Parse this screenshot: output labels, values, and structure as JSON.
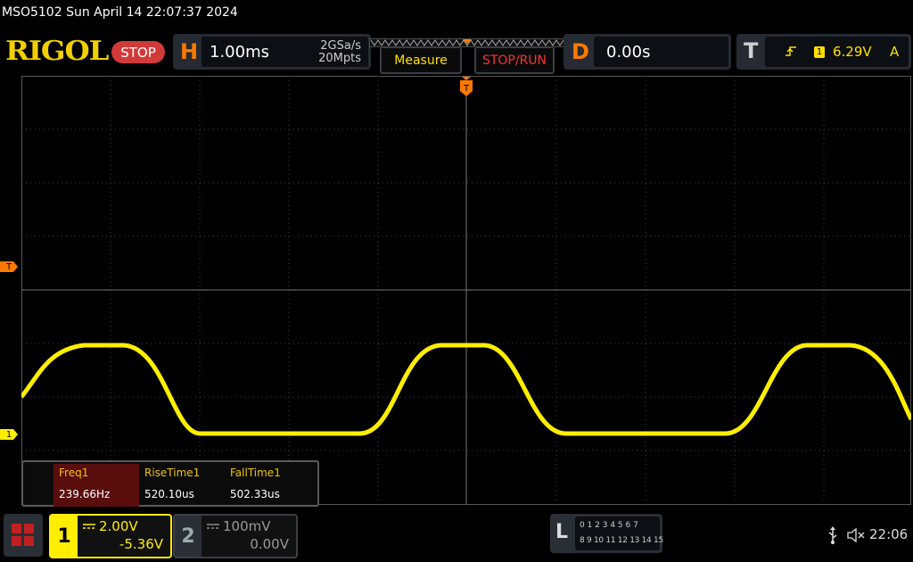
{
  "status_bar": {
    "text": "MSO5102  Sun April 14 22:07:37 2024"
  },
  "brand": {
    "logo": "RIGOL",
    "run_state": "STOP"
  },
  "horizontal": {
    "letter": "H",
    "timebase": "1.00ms",
    "sample_rate": "2GSa/s",
    "memory_depth": "20Mpts"
  },
  "buttons": {
    "measure": "Measure",
    "stop_run": "STOP/RUN"
  },
  "delay": {
    "letter": "D",
    "value": "0.00s"
  },
  "trigger": {
    "letter": "T",
    "source": "1",
    "level": "6.29V",
    "mode": "A"
  },
  "markers": {
    "trigger_level": "T",
    "channel1": "1"
  },
  "measurements": {
    "items": [
      {
        "label": "Freq1",
        "value": "239.66Hz"
      },
      {
        "label": "RiseTime1",
        "value": "520.10us"
      },
      {
        "label": "FallTime1",
        "value": "502.33us"
      }
    ]
  },
  "channel1": {
    "number": "1",
    "scale": "2.00V",
    "offset": "-5.36V"
  },
  "channel2": {
    "number": "2",
    "scale": "100mV",
    "offset": "0.00V"
  },
  "logic": {
    "letter": "L",
    "row1": "0 1 2 3  4 5 6 7",
    "row2": "8 9 10 11 12 13 14 15"
  },
  "system": {
    "time": "22:06"
  },
  "colors": {
    "ch1": "#ffee00",
    "accent": "#ff7a00",
    "stop": "#d23a3a",
    "panel": "#262b33"
  }
}
